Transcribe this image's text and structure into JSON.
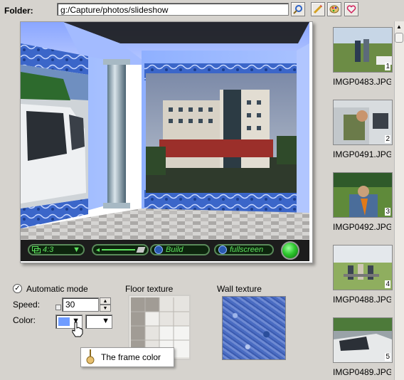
{
  "folder": {
    "label": "Folder:",
    "path": "g:/Capture/photos/slideshow"
  },
  "toolbar": {
    "icons": [
      "browse-folder-icon",
      "pencil-icon",
      "palette-icon",
      "heart-icon"
    ]
  },
  "preview_controls": {
    "aspect": "4:3",
    "build": "Build",
    "fullscreen": "fullscreen"
  },
  "settings": {
    "automatic_mode_label": "Automatic mode",
    "automatic_mode_checked": true,
    "speed_label": "Speed:",
    "speed_value": "30",
    "color_label": "Color:",
    "frame_color": "#6f9cff",
    "floor_texture_label": "Floor texture",
    "wall_texture_label": "Wall texture",
    "tooltip": "The frame color"
  },
  "thumbnails": [
    {
      "number": "1",
      "name": "IMGP0483.JPG"
    },
    {
      "number": "2",
      "name": "IMGP0491.JPG"
    },
    {
      "number": "3",
      "name": "IMGP0492.JPG"
    },
    {
      "number": "4",
      "name": "IMGP0488.JPG"
    },
    {
      "number": "5",
      "name": "IMGP0489.JPG"
    }
  ]
}
